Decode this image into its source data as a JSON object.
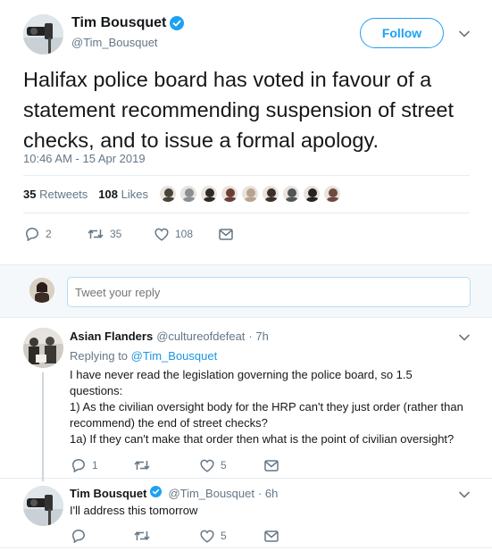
{
  "tweet": {
    "author_name": "Tim Bousquet",
    "author_handle": "@Tim_Bousquet",
    "follow_label": "Follow",
    "text": "Halifax police board has voted in favour of a statement recommending suspension of street checks, and to issue a formal apology.",
    "timestamp": "10:46 AM - 15 Apr 2019",
    "retweets_count": "35",
    "retweets_label": "Retweets",
    "likes_count": "108",
    "likes_label": "Likes",
    "liker_colors": [
      "#4a4238",
      "#8a8f92",
      "#2f2a24",
      "#6b3e35",
      "#b7a48f",
      "#3d2f2a",
      "#515558",
      "#272320",
      "#704a41"
    ],
    "actions": {
      "reply_count": "2",
      "retweet_count": "35",
      "like_count": "108"
    }
  },
  "reply_box": {
    "placeholder": "Tweet your reply"
  },
  "replies": [
    {
      "author_name": "Asian Flanders",
      "author_handle": "@cultureofdefeat",
      "time": "· 7h",
      "replying_prefix": "Replying to",
      "replying_to": "@Tim_Bousquet",
      "lines": [
        "I have never read the legislation governing the police board, so 1.5",
        "questions:",
        "1) As the civilian oversight body for the HRP can't they just order (rather than",
        "recommend) the end of street checks?",
        "1a) If they can't make that order then what is the point of civilian oversight?"
      ],
      "reply_count": "1",
      "retweet_count": "",
      "like_count": "5"
    },
    {
      "author_name": "Tim Bousquet",
      "author_handle": "@Tim_Bousquet",
      "time": "· 6h",
      "lines": [
        "I'll address this tomorrow"
      ],
      "reply_count": "",
      "retweet_count": "",
      "like_count": "5"
    }
  ],
  "colors": {
    "accent": "#1da1f2",
    "link": "#1b95e0",
    "muted": "#657786",
    "verified": "#1da1f2"
  }
}
